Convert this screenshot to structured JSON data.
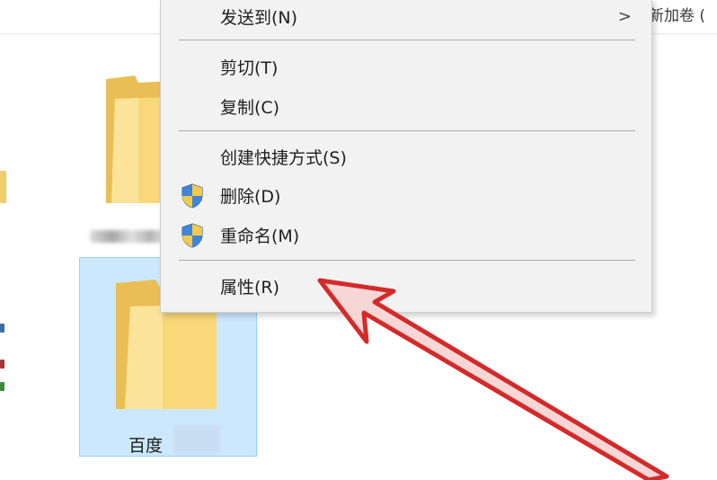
{
  "window": {
    "breadcrumb_tail": "新加卷 ("
  },
  "folders": [
    {
      "label": ""
    },
    {
      "label": ""
    },
    {
      "label": "百度"
    }
  ],
  "context_menu": {
    "items": [
      {
        "label": "发送到(N)",
        "has_submenu": true,
        "submenu_arrow": ">"
      },
      {
        "label": "剪切(T)"
      },
      {
        "label": "复制(C)"
      },
      {
        "label": "创建快捷方式(S)"
      },
      {
        "label": "删除(D)",
        "icon": "uac-shield-icon"
      },
      {
        "label": "重命名(M)",
        "icon": "uac-shield-icon"
      },
      {
        "label": "属性(R)"
      }
    ]
  },
  "colors": {
    "menu_background": "#f2f2f2",
    "selection_background": "#cce8ff",
    "selection_border": "#99d1ff",
    "annotation_arrow": "#d42a2a",
    "folder_yellow": "#f6d776"
  }
}
